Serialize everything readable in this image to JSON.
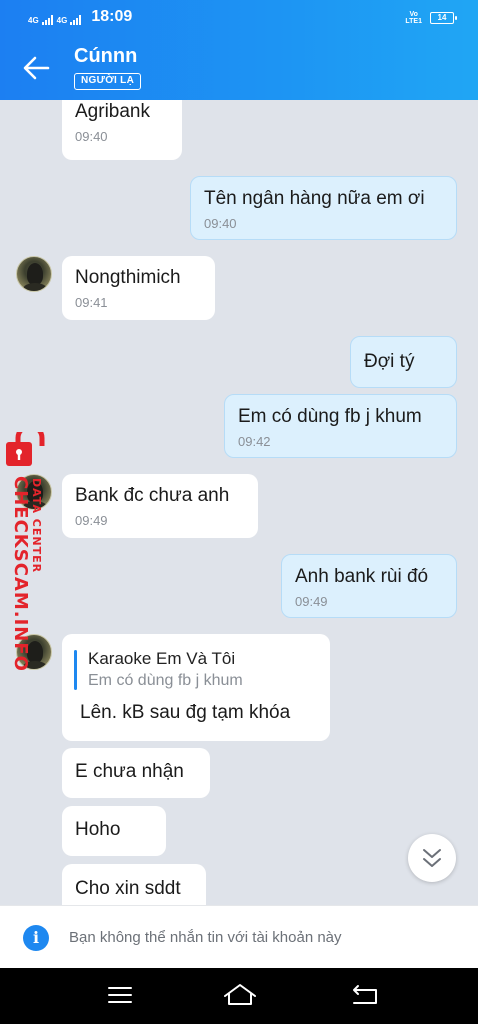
{
  "status_bar": {
    "sim1_label": "4G",
    "sim2_label": "4G",
    "time": "18:09",
    "volte_top": "Vo",
    "volte_bottom": "LTE1",
    "battery_level": "14"
  },
  "header": {
    "contact_name": "Cúnnn",
    "stranger_badge": "NGƯỜI LẠ"
  },
  "messages": [
    {
      "direction": "in",
      "text": "Agribank",
      "time": "09:40"
    },
    {
      "direction": "out",
      "text": "Tên ngân hàng nữa em ơi",
      "time": "09:40"
    },
    {
      "direction": "in",
      "text": "Nongthimich",
      "time": "09:41"
    },
    {
      "direction": "out",
      "text": "Đợi tý",
      "time": ""
    },
    {
      "direction": "out",
      "text": "Em có dùng fb j khum",
      "time": "09:42"
    },
    {
      "direction": "in",
      "text": "Bank đc chưa anh",
      "time": "09:49"
    },
    {
      "direction": "out",
      "text": "Anh bank rùi đó",
      "time": "09:49"
    },
    {
      "direction": "in",
      "quote_title": "Karaoke Em Và Tôi",
      "quote_text": "Em có dùng fb j khum",
      "text": "Lên. kB sau đg tạm khóa",
      "time": ""
    },
    {
      "direction": "in",
      "text": "E chưa nhận",
      "time": ""
    },
    {
      "direction": "in",
      "text": "Hoho",
      "time": ""
    },
    {
      "direction": "in",
      "text": "Cho xin sddt",
      "time": ""
    }
  ],
  "watermark": {
    "main": "CHECKSCAM.INFO",
    "sub": "DATA CENTER"
  },
  "notice": {
    "text": "Bạn không thể nhắn tin với tài khoản này"
  },
  "colors": {
    "header_start": "#1c7ff2",
    "header_end": "#20a6f4",
    "chat_background": "#dfe3ea",
    "incoming_bubble": "#ffffff",
    "outgoing_bubble": "#dcf0fd",
    "accent": "#1e88f0",
    "watermark": "#e3242b"
  },
  "icons": {
    "back": "arrow-left-icon",
    "scroll_down": "double-chevron-down-icon",
    "info": "info-icon",
    "nav_menu": "menu-icon",
    "nav_home": "home-icon",
    "nav_back": "back-icon"
  }
}
